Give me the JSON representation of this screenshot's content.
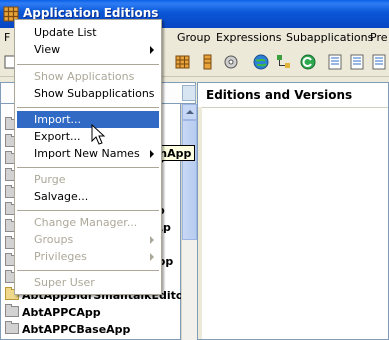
{
  "window": {
    "title": "Application Editions"
  },
  "menubar": {
    "items": [
      "F",
      "Group",
      "Expressions",
      "Subapplications",
      "Pre"
    ]
  },
  "toolbar": {
    "icons": [
      "lattice-icon",
      "grid-icon",
      "gear-icon",
      "globe-icon",
      "hierarchy-icon",
      "refresh-icon",
      "list-icon",
      "list-icon",
      "list-icon"
    ]
  },
  "right_pane": {
    "header": "Editions and Versions"
  },
  "left_list": {
    "partial_rows": [
      "eo",
      "p",
      "pp",
      "rAp",
      "App",
      "d",
      "d"
    ],
    "items": [
      "AbtAppBldrSmalltalkEdito",
      "AbtAPPCApp",
      "AbtAPPCBaseApp"
    ]
  },
  "tooltip": {
    "text": "grationApp"
  },
  "context_menu": {
    "items": [
      {
        "label": "Update List",
        "enabled": true,
        "submenu": false
      },
      {
        "label": "View",
        "enabled": true,
        "submenu": true
      },
      {
        "label": "Show Applications",
        "enabled": false,
        "submenu": false
      },
      {
        "label": "Show Subapplications",
        "enabled": true,
        "submenu": false
      },
      {
        "label": "Import...",
        "enabled": true,
        "submenu": false,
        "selected": true
      },
      {
        "label": "Export...",
        "enabled": true,
        "submenu": false
      },
      {
        "label": "Import New Names",
        "enabled": true,
        "submenu": true
      },
      {
        "label": "Purge",
        "enabled": false,
        "submenu": false
      },
      {
        "label": "Salvage...",
        "enabled": true,
        "submenu": false
      },
      {
        "label": "Change Manager...",
        "enabled": false,
        "submenu": false
      },
      {
        "label": "Groups",
        "enabled": false,
        "submenu": true
      },
      {
        "label": "Privileges",
        "enabled": false,
        "submenu": true
      },
      {
        "label": "Super User",
        "enabled": false,
        "submenu": false
      }
    ]
  },
  "colors": {
    "title_bar": "#0A56D6",
    "menu_highlight": "#316AC5",
    "disabled_text": "#ACA899",
    "tooltip_bg": "#FFFFE1"
  }
}
